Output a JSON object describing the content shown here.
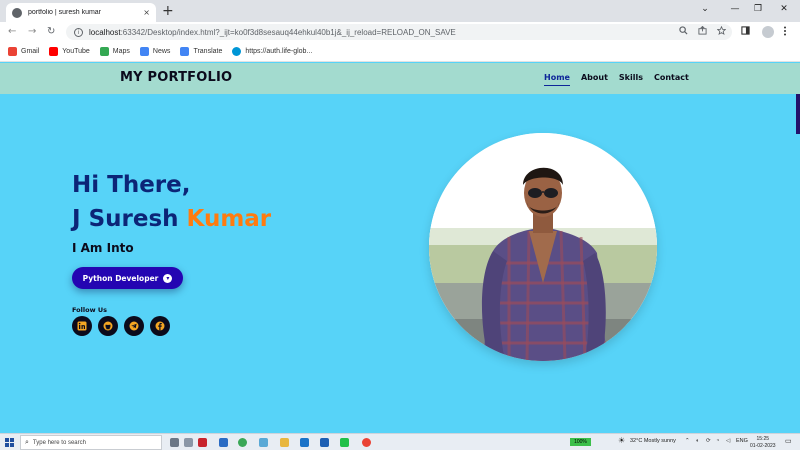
{
  "browser": {
    "tab_title": "portfolio | suresh kumar",
    "tab_close": "×",
    "new_tab": "+",
    "window_controls": {
      "collapse": "⌄",
      "minimize": "—",
      "restore": "❐",
      "close": "✕"
    },
    "nav": {
      "back": "←",
      "forward": "→",
      "reload": "↻"
    },
    "url_host": "localhost",
    "url_rest": ":63342/Desktop/index.html?_ijt=ko0f3d8sesauq44ehkul40b1j&_ij_reload=RELOAD_ON_SAVE",
    "bookmarks": [
      {
        "label": "Gmail",
        "color": "#ea4335"
      },
      {
        "label": "YouTube",
        "color": "#ff0000"
      },
      {
        "label": "Maps",
        "color": "#34a853"
      },
      {
        "label": "News",
        "color": "#4285f4"
      },
      {
        "label": "Translate",
        "color": "#4285f4"
      },
      {
        "label": "https://auth.life-glob...",
        "color": "#0096d6"
      }
    ]
  },
  "site": {
    "brand": "MY PORTFOLIO",
    "nav": [
      {
        "label": "Home",
        "active": true
      },
      {
        "label": "About",
        "active": false
      },
      {
        "label": "Skills",
        "active": false
      },
      {
        "label": "Contact",
        "active": false
      }
    ],
    "hero": {
      "greeting": "Hi There,",
      "name_first": "J Suresh ",
      "name_accent": "Kumar",
      "into": "I Am Into",
      "role": "Python Developer",
      "follow_label": "Follow Us",
      "socials": [
        "linkedin-icon",
        "github-icon",
        "telegram-icon",
        "facebook-icon"
      ]
    },
    "colors": {
      "background": "#57d3f8",
      "nav_bg": "#a3dbcf",
      "title": "#0c2577",
      "accent": "#ff7b0f",
      "button": "#2405b2"
    }
  },
  "taskbar": {
    "search_placeholder": "Type here to search",
    "battery": "100%",
    "weather": "32°C  Mostly sunny",
    "lang": "ENG",
    "time": "15:25",
    "date": "01-02-2023"
  }
}
